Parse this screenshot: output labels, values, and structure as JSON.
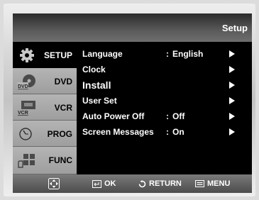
{
  "header": {
    "title": "Setup"
  },
  "sidebar": {
    "items": [
      {
        "label": "SETUP",
        "icon": "gear-icon",
        "active": true
      },
      {
        "label": "DVD",
        "icon": "dvd-disc-icon",
        "badge": "DVD",
        "active": false
      },
      {
        "label": "VCR",
        "icon": "vcr-cassette-icon",
        "badge": "VCR",
        "active": false
      },
      {
        "label": "PROG",
        "icon": "clock-timer-icon",
        "active": false
      },
      {
        "label": "FUNC",
        "icon": "function-grid-icon",
        "active": false
      }
    ]
  },
  "menu": {
    "rows": [
      {
        "label": "Language",
        "value": "English",
        "has_value": true
      },
      {
        "label": "Clock",
        "value": "",
        "has_value": false
      },
      {
        "label": "Install",
        "value": "",
        "has_value": false
      },
      {
        "label": "User Set",
        "value": "",
        "has_value": false
      },
      {
        "label": "Auto Power Off",
        "value": "Off",
        "has_value": true
      },
      {
        "label": "Screen Messages",
        "value": "On",
        "has_value": true
      }
    ],
    "separator": ":"
  },
  "footer": {
    "nav_icon": "dpad-icon",
    "ok_label": "OK",
    "return_label": "RETURN",
    "menu_label": "MENU"
  },
  "colors": {
    "background": "#000000",
    "sidebar_inactive": "#b4b4b4",
    "text": "#ffffff"
  }
}
